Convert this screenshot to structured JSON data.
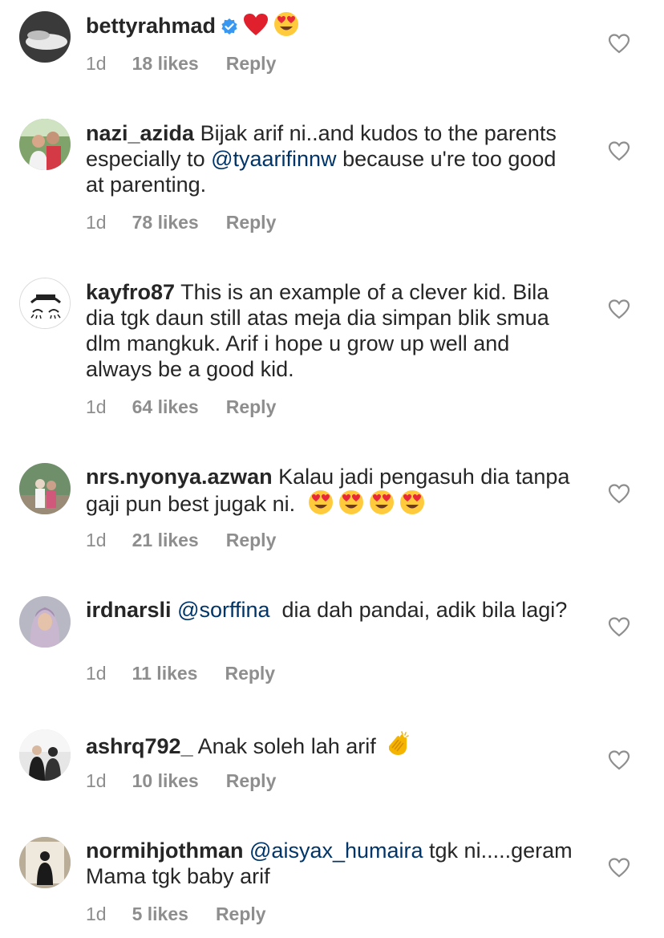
{
  "comments": [
    {
      "username": "bettyrahmad",
      "verified": true,
      "text": "",
      "mention": "",
      "text_after": "",
      "emoji": [
        "red-heart",
        "heart-eyes"
      ],
      "time": "1d",
      "likes": "18 likes",
      "reply": "Reply"
    },
    {
      "username": "nazi_azida",
      "verified": false,
      "text": "Bijak arif ni..and kudos to the parents especially to ",
      "mention": "@tyaarifinnw",
      "text_after": " because u're too good at parenting.",
      "emoji": [],
      "time": "1d",
      "likes": "78 likes",
      "reply": "Reply"
    },
    {
      "username": "kayfro87",
      "verified": false,
      "text": "This is an example of a clever kid. Bila dia tgk daun still atas meja dia simpan blik smua dlm mangkuk. Arif i hope u grow up well and always be a good kid.",
      "mention": "",
      "text_after": "",
      "emoji": [],
      "time": "1d",
      "likes": "64 likes",
      "reply": "Reply"
    },
    {
      "username": "nrs.nyonya.azwan",
      "verified": false,
      "text": "Kalau jadi pengasuh dia tanpa gaji pun best jugak ni.",
      "mention": "",
      "text_after": "",
      "emoji": [
        "heart-eyes",
        "heart-eyes",
        "heart-eyes",
        "heart-eyes"
      ],
      "time": "1d",
      "likes": "21 likes",
      "reply": "Reply"
    },
    {
      "username": "irdnarsli",
      "verified": false,
      "text": "",
      "mention": "@sorffina",
      "text_after": "  dia dah pandai, adik bila lagi?",
      "emoji": [],
      "time": "1d",
      "likes": "11 likes",
      "reply": "Reply"
    },
    {
      "username": "ashrq792_",
      "verified": false,
      "text": "Anak soleh lah arif",
      "mention": "",
      "text_after": "",
      "emoji": [
        "clapping-hands"
      ],
      "time": "1d",
      "likes": "10 likes",
      "reply": "Reply"
    },
    {
      "username": "normihjothman",
      "verified": false,
      "text": "",
      "mention": "@aisyax_humaira",
      "text_after": " tgk ni.....geram Mama tgk baby arif",
      "emoji": [],
      "time": "1d",
      "likes": "5 likes",
      "reply": "Reply"
    }
  ],
  "colors": {
    "text": "#262626",
    "meta": "#8e8e8e",
    "mention": "#003569",
    "verified": "#3897f0"
  }
}
